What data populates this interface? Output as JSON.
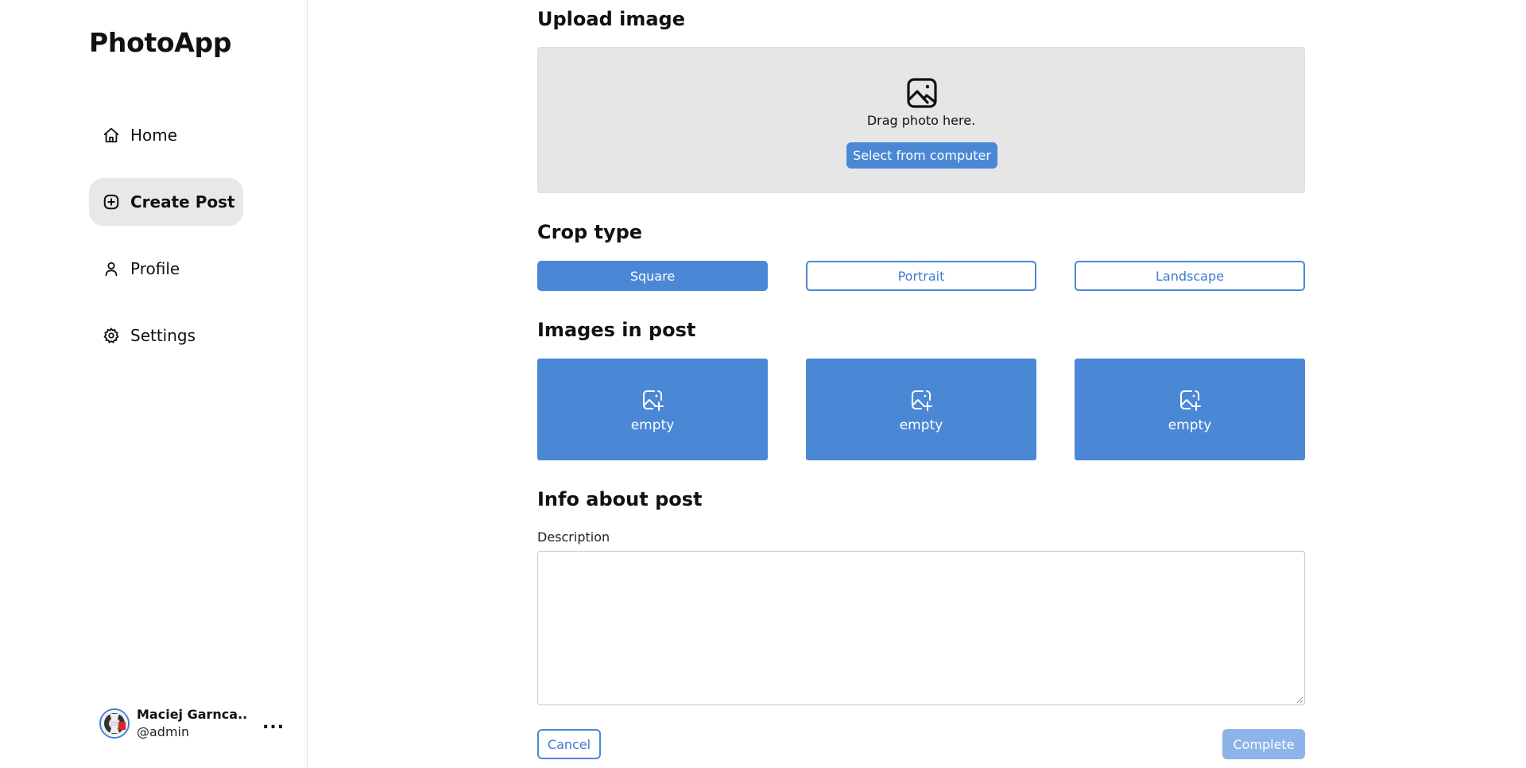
{
  "app": {
    "title": "PhotoApp"
  },
  "sidebar": {
    "items": [
      {
        "label": "Home",
        "icon": "home-icon",
        "active": false
      },
      {
        "label": "Create Post",
        "icon": "plus-square-icon",
        "active": true
      },
      {
        "label": "Profile",
        "icon": "user-icon",
        "active": false
      },
      {
        "label": "Settings",
        "icon": "gear-icon",
        "active": false
      }
    ],
    "user": {
      "name": "Maciej Garnca...",
      "handle": "@admin",
      "more_label": "..."
    }
  },
  "upload": {
    "title": "Upload image",
    "drop_text": "Drag photo here.",
    "select_button": "Select from computer"
  },
  "crop": {
    "title": "Crop type",
    "options": [
      "Square",
      "Portrait",
      "Landscape"
    ],
    "selected": "Square"
  },
  "images": {
    "title": "Images in post",
    "slots": [
      {
        "label": "empty"
      },
      {
        "label": "empty"
      },
      {
        "label": "empty"
      }
    ]
  },
  "info": {
    "title": "Info about post",
    "description_label": "Description",
    "description_value": ""
  },
  "actions": {
    "cancel": "Cancel",
    "complete": "Complete"
  },
  "colors": {
    "accent": "#4a88d6",
    "accent_disabled": "#8cb4ea",
    "nav_active_bg": "#e8e8e8",
    "dropzone_bg": "#e6e6e6"
  }
}
